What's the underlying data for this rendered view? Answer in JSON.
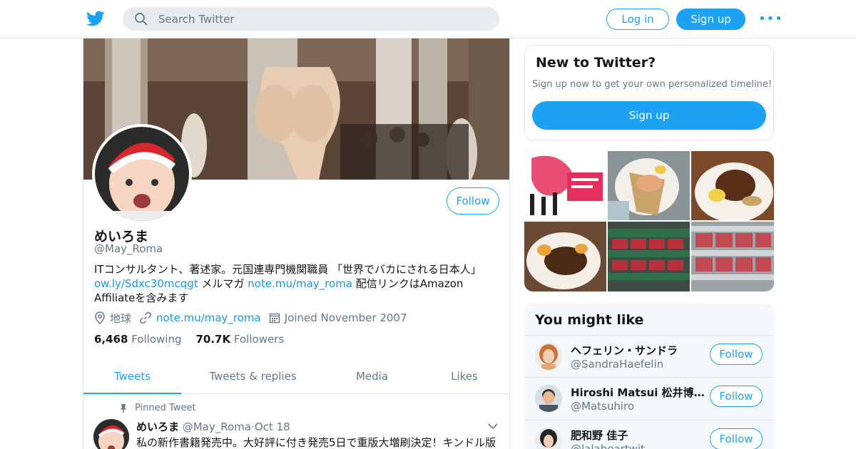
{
  "header": {
    "search_placeholder": "Search Twitter",
    "login_label": "Log in",
    "signup_label": "Sign up",
    "more_label": "•••"
  },
  "profile": {
    "follow_label": "Follow",
    "name": "めいろま",
    "handle": "@May_Roma",
    "bio_text1": "ITコンサルタント、著述家。元国連専門機関職員 「世界でバカにされる日本人」",
    "bio_link1": "ow.ly/Sdxc30mcqgt",
    "bio_text2": " メルマガ ",
    "bio_link2": "note.mu/may_roma",
    "bio_text3": " 配信リンクはAmazon Affiliateを含みます",
    "location": "地球",
    "website": "note.mu/may_roma",
    "joined": "Joined November 2007",
    "following_count": "6,468",
    "following_label": "Following",
    "followers_count": "70.7K",
    "followers_label": "Followers"
  },
  "tabs": [
    {
      "label": "Tweets"
    },
    {
      "label": "Tweets & replies"
    },
    {
      "label": "Media"
    },
    {
      "label": "Likes"
    }
  ],
  "pinned_tweet": {
    "pinned_label": "Pinned Tweet",
    "author": "めいろま",
    "handle": "@May_Roma",
    "separator": "·",
    "date": "Oct 18",
    "text": "私の新作書籍発売中。大好評に付き発売5日で重版大増刷決定！キンドル版"
  },
  "sidebar": {
    "new_title": "New to Twitter?",
    "new_sub": "Sign up now to get your own personalized timeline!",
    "new_cta": "Sign up",
    "might_title": "You might like",
    "suggestions": [
      {
        "name": "ヘフェリン・サンドラ",
        "handle": "@SandraHaefelin",
        "follow": "Follow"
      },
      {
        "name": "Hiroshi Matsui 松井博@B...",
        "handle": "@Matsuhiro",
        "follow": "Follow"
      },
      {
        "name": "肥和野 佳子",
        "handle": "@lalaheartwit",
        "follow": "Follow"
      }
    ]
  },
  "colors": {
    "accent": "#1da1f2",
    "link": "#1b95e0",
    "muted": "#657786",
    "border": "#e1e8ed"
  },
  "icons": [
    "twitter-bird-icon",
    "search-icon",
    "more-dots-icon",
    "location-icon",
    "link-icon",
    "calendar-icon",
    "pin-icon",
    "chevron-down-icon"
  ]
}
